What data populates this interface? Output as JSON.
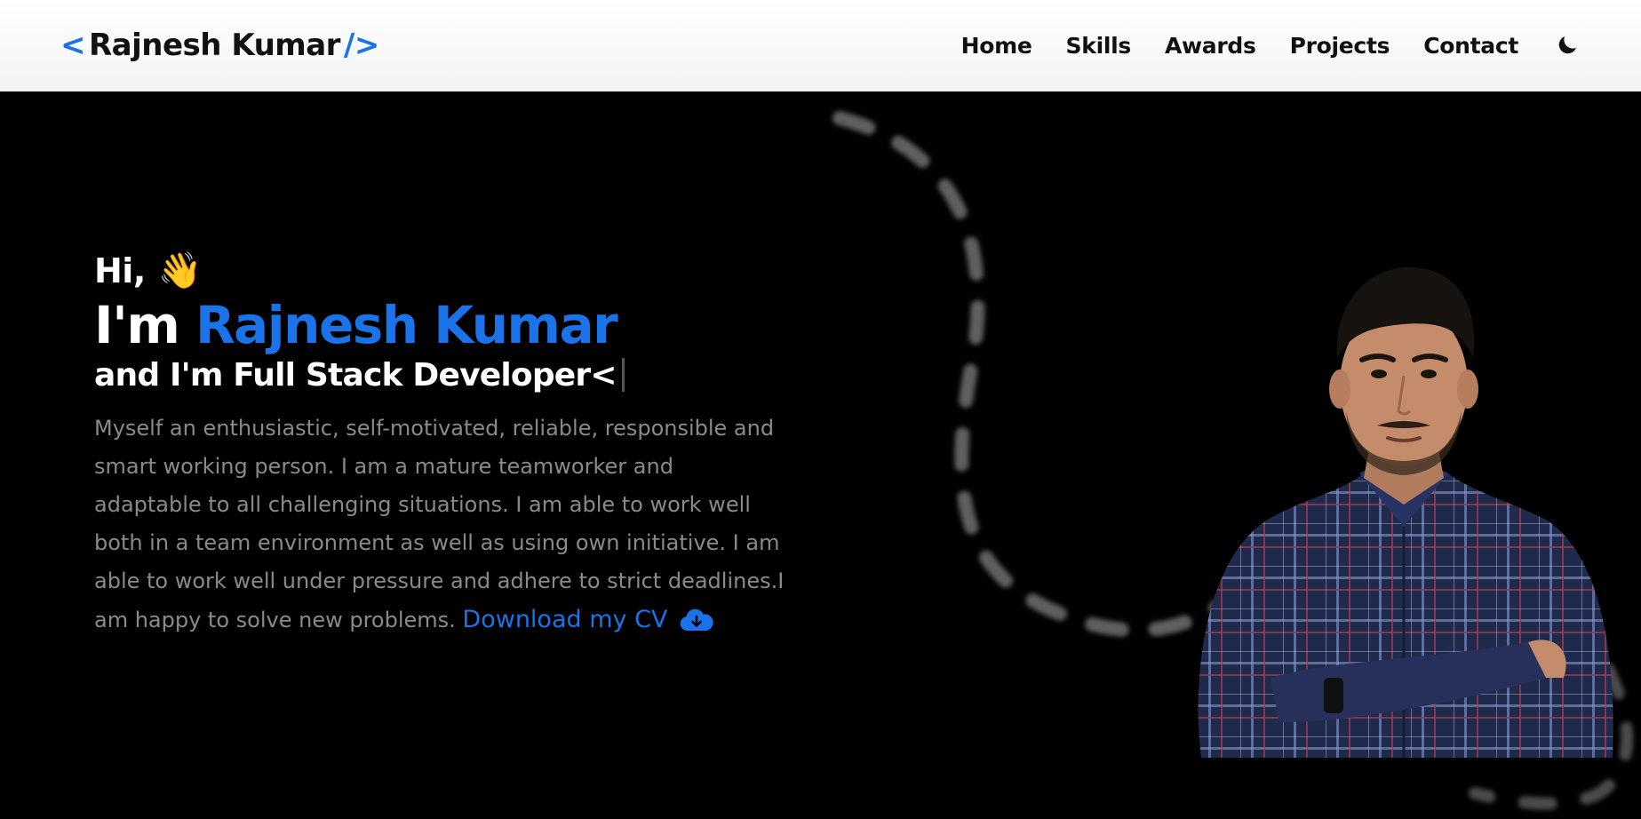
{
  "brand": {
    "open": "<",
    "name": "Rajnesh Kumar",
    "close": "/>"
  },
  "nav": {
    "items": [
      "Home",
      "Skills",
      "Awards",
      "Projects",
      "Contact"
    ],
    "theme_icon": "moon-icon"
  },
  "hero": {
    "greeting": "Hi,",
    "wave_emoji": "👋",
    "intro_prefix": "I'm",
    "intro_name": "Rajnesh Kumar",
    "role_line": "and I'm Full Stack Developer<",
    "description": "Myself an enthusiastic, self-motivated, reliable, responsible and smart working person. I am a mature teamworker and adaptable to all challenging situations. I am able to work well both in a team environment as well as using own initiative. I am able to work well under pressure and adhere to strict deadlines.I am happy to solve new problems.",
    "cv_label": "Download my CV",
    "cv_icon": "cloud-download-icon"
  },
  "colors": {
    "accent": "#1a73e8",
    "background": "#000000",
    "navbar": "#ffffff",
    "text_muted": "#8a8a8a"
  }
}
